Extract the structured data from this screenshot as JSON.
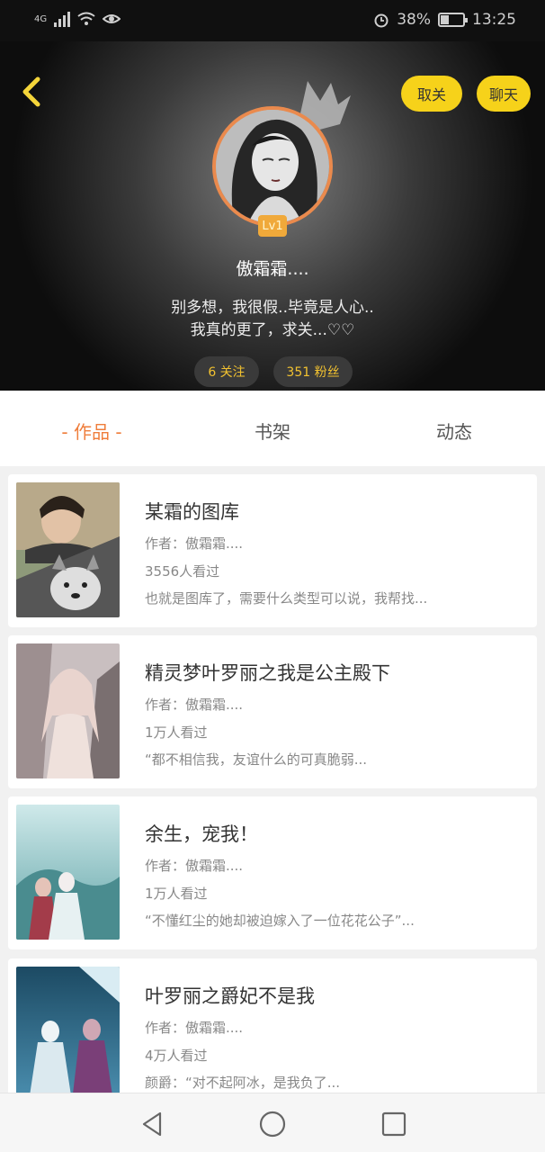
{
  "status": {
    "network": "4G",
    "battery": "38%",
    "battery_level": 0.38,
    "time": "13:25"
  },
  "header": {
    "unfollow_label": "取关",
    "chat_label": "聊天",
    "level": "Lv1",
    "nickname": "傲霜霜....",
    "bio_line1": "别多想，我很假..毕竟是人心..",
    "bio_line2": "我真的更了，求关...♡♡",
    "following": "6 关注",
    "fans": "351 粉丝"
  },
  "tabs": [
    "- 作品 -",
    "书架",
    "动态"
  ],
  "books": [
    {
      "title": "某霜的图库",
      "author": "作者：傲霜霜....",
      "views": "3556人看过",
      "desc": "也就是图库了，需要什么类型可以说，我帮找..."
    },
    {
      "title": "精灵梦叶罗丽之我是公主殿下",
      "author": "作者：傲霜霜....",
      "views": "1万人看过",
      "desc": "“都不相信我，友谊什么的可真脆弱..."
    },
    {
      "title": "余生，宠我！",
      "author": "作者：傲霜霜....",
      "views": "1万人看过",
      "desc": "“不懂红尘的她却被迫嫁入了一位花花公子”..."
    },
    {
      "title": "叶罗丽之爵妃不是我",
      "author": "作者：傲霜霜....",
      "views": "4万人看过",
      "desc": "颜爵：“对不起阿冰，是我负了..."
    }
  ],
  "colors": {
    "accent": "#ef7d3b",
    "pill": "#f6d21a",
    "chip_text": "#f2c230",
    "level": "#f0a93a"
  },
  "icons": [
    "back-chevron-icon",
    "crown-icon",
    "nav-back-icon",
    "nav-home-icon",
    "nav-recents-icon"
  ]
}
